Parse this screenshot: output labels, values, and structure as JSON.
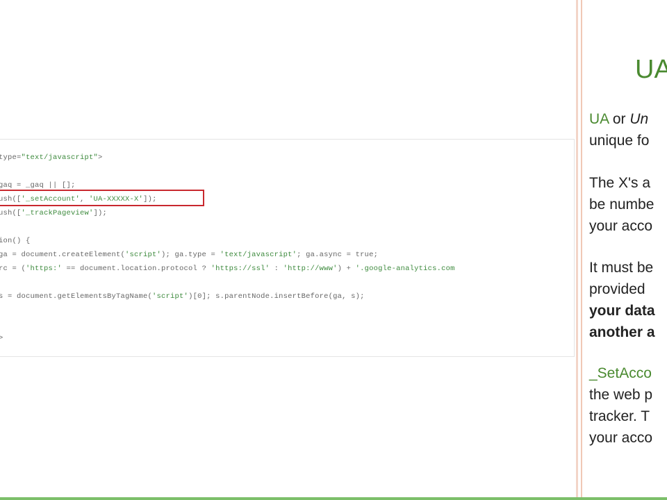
{
  "code": {
    "lines": [
      [
        {
          "t": "type=",
          "c": ""
        },
        {
          "t": "\"text/javascript\"",
          "c": "g"
        },
        {
          "t": ">",
          "c": ""
        }
      ],
      [
        {
          "t": "gaq = _gaq || [];",
          "c": ""
        }
      ],
      [
        {
          "t": "ush([",
          "c": ""
        },
        {
          "t": "'_setAccount'",
          "c": "g"
        },
        {
          "t": ", ",
          "c": ""
        },
        {
          "t": "'UA-XXXXX-X'",
          "c": "g"
        },
        {
          "t": "]);",
          "c": ""
        }
      ],
      [
        {
          "t": "ush([",
          "c": ""
        },
        {
          "t": "'_trackPageview'",
          "c": "g"
        },
        {
          "t": "]);",
          "c": ""
        }
      ],
      [
        {
          "t": "ion() {",
          "c": ""
        }
      ],
      [
        {
          "t": "ga = document.createElement(",
          "c": ""
        },
        {
          "t": "'script'",
          "c": "g"
        },
        {
          "t": "); ga.type = ",
          "c": ""
        },
        {
          "t": "'text/javascript'",
          "c": "g"
        },
        {
          "t": "; ga.async = true;",
          "c": ""
        }
      ],
      [
        {
          "t": "rc = (",
          "c": ""
        },
        {
          "t": "'https:'",
          "c": "g"
        },
        {
          "t": " == document.location.protocol ? ",
          "c": ""
        },
        {
          "t": "'https://ssl'",
          "c": "g"
        },
        {
          "t": " : ",
          "c": ""
        },
        {
          "t": "'http://www'",
          "c": "g"
        },
        {
          "t": ") + ",
          "c": ""
        },
        {
          "t": "'.google-analytics.com",
          "c": "g"
        }
      ],
      [
        {
          "t": "s = document.getElementsByTagName(",
          "c": ""
        },
        {
          "t": "'script'",
          "c": "g"
        },
        {
          "t": ")[0]; s.parentNode.insertBefore(ga, s);",
          "c": ""
        }
      ],
      [
        {
          "t": ">",
          "c": ""
        }
      ]
    ]
  },
  "side": {
    "title": "UA",
    "p1a": "UA",
    "p1b": " or ",
    "p1c": "Un",
    "p1d": "unique fo",
    "p2a": "The X's a",
    "p2b": "be numbe",
    "p2c": "your acco",
    "p3a": "It must be",
    "p3b": "provided",
    "p3c": "your data",
    "p3d": "another a",
    "p4a": "_SetAcco",
    "p4b": "the web p",
    "p4c": "tracker.  T",
    "p4d": "your acco"
  }
}
